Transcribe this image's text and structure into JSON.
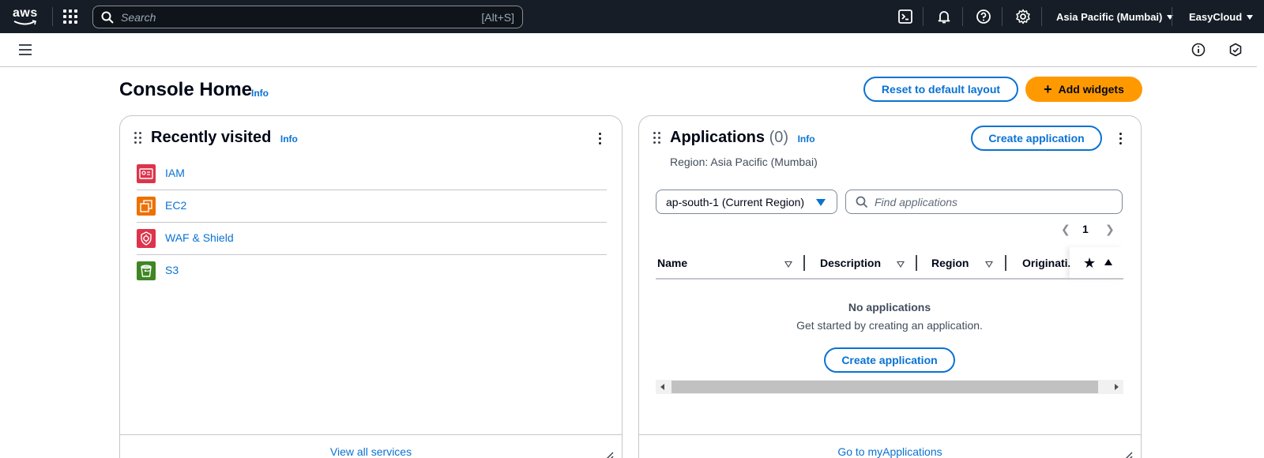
{
  "topnav": {
    "logo_text": "aws",
    "search_placeholder": "Search",
    "search_shortcut": "[Alt+S]",
    "region": "Asia Pacific (Mumbai)",
    "account": "EasyCloud",
    "icons": [
      "grid-icon",
      "cloudshell-icon",
      "bell-icon",
      "help-icon",
      "gear-icon"
    ]
  },
  "subbar": {
    "icons": [
      "menu-icon",
      "info-circle-icon",
      "security-icon"
    ]
  },
  "header": {
    "title": "Console Home",
    "info": "Info",
    "reset_button": "Reset to default layout",
    "add_widgets_button": "Add widgets"
  },
  "recently_visited": {
    "title": "Recently visited",
    "info": "Info",
    "items": [
      {
        "label": "IAM",
        "icon": "iam-icon",
        "color": "#dd344c"
      },
      {
        "label": "EC2",
        "icon": "ec2-icon",
        "color": "#ed7100"
      },
      {
        "label": "WAF & Shield",
        "icon": "waf-shield-icon",
        "color": "#dd344c"
      },
      {
        "label": "S3",
        "icon": "s3-icon",
        "color": "#3f8624"
      }
    ],
    "footer_link": "View all services"
  },
  "applications": {
    "title": "Applications",
    "count": "(0)",
    "info": "Info",
    "create_button": "Create application",
    "region_text": "Region: Asia Pacific (Mumbai)",
    "region_select": "ap-south-1 (Current Region)",
    "find_placeholder": "Find applications",
    "page_number": "1",
    "columns": [
      "Name",
      "Description",
      "Region",
      "Originati..."
    ],
    "empty_title": "No applications",
    "empty_subtitle": "Get started by creating an application.",
    "empty_create_button": "Create application",
    "footer_link": "Go to myApplications"
  },
  "colors": {
    "nav_bg": "#161d26",
    "link": "#0972d3",
    "primary": "#ff9900"
  }
}
